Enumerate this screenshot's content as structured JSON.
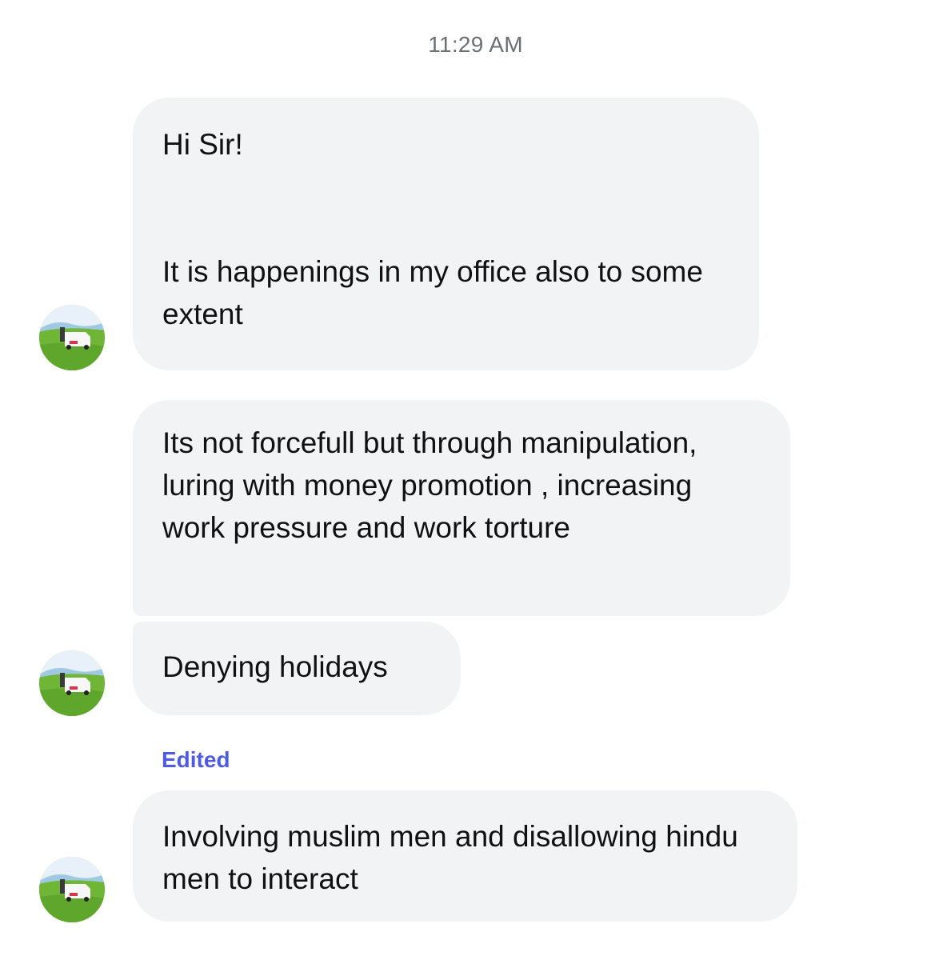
{
  "chat": {
    "timestamp": "11:29 AM",
    "messages": [
      {
        "text": "Hi Sir!\n\n\nIt is happenings in my office also to some extent"
      },
      {
        "text": "Its not forcefull but through manipulation, luring with money promotion , increasing work pressure and work torture"
      },
      {
        "text": "Denying holidays"
      },
      {
        "edited_label": "Edited",
        "text": "Involving muslim men and disallowing hindu men to interact"
      }
    ]
  },
  "colors": {
    "bubble_background": "#f2f3f5",
    "timestamp_text": "#6b6f76",
    "edited_label": "#4f5be0",
    "message_text": "#111111"
  },
  "icons": {
    "avatar": "profile-photo-car-on-grass"
  }
}
